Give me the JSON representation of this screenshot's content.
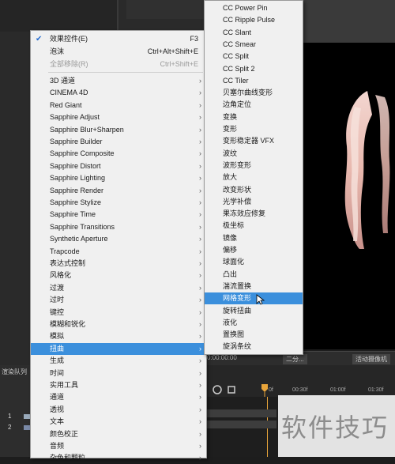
{
  "menu": {
    "items": [
      {
        "label": "效果控件(E)",
        "shortcut": "F3",
        "checked": true
      },
      {
        "label": "泡沫",
        "shortcut": "Ctrl+Alt+Shift+E"
      },
      {
        "label": "全部移除(R)",
        "shortcut": "Ctrl+Shift+E",
        "disabled": true
      },
      {
        "label": "3D 通道"
      },
      {
        "label": "CINEMA 4D"
      },
      {
        "label": "Red Giant"
      },
      {
        "label": "Sapphire Adjust"
      },
      {
        "label": "Sapphire Blur+Sharpen"
      },
      {
        "label": "Sapphire Builder"
      },
      {
        "label": "Sapphire Composite"
      },
      {
        "label": "Sapphire Distort"
      },
      {
        "label": "Sapphire Lighting"
      },
      {
        "label": "Sapphire Render"
      },
      {
        "label": "Sapphire Stylize"
      },
      {
        "label": "Sapphire Time"
      },
      {
        "label": "Sapphire Transitions"
      },
      {
        "label": "Synthetic Aperture"
      },
      {
        "label": "Trapcode"
      },
      {
        "label": "表达式控制"
      },
      {
        "label": "风格化"
      },
      {
        "label": "过渡"
      },
      {
        "label": "过时"
      },
      {
        "label": "键控"
      },
      {
        "label": "模糊和锐化"
      },
      {
        "label": "模拟"
      },
      {
        "label": "扭曲",
        "highlighted": true
      },
      {
        "label": "生成"
      },
      {
        "label": "时间"
      },
      {
        "label": "实用工具"
      },
      {
        "label": "通道"
      },
      {
        "label": "透视"
      },
      {
        "label": "文本"
      },
      {
        "label": "颜色校正"
      },
      {
        "label": "音频"
      },
      {
        "label": "杂色和颗粒"
      }
    ]
  },
  "submenu": {
    "items": [
      {
        "label": "CC Power Pin"
      },
      {
        "label": "CC Ripple Pulse"
      },
      {
        "label": "CC Slant"
      },
      {
        "label": "CC Smear"
      },
      {
        "label": "CC Split"
      },
      {
        "label": "CC Split 2"
      },
      {
        "label": "CC Tiler"
      },
      {
        "label": "贝塞尔曲线变形"
      },
      {
        "label": "边角定位"
      },
      {
        "label": "变换"
      },
      {
        "label": "变形"
      },
      {
        "label": "变形稳定器 VFX"
      },
      {
        "label": "波纹"
      },
      {
        "label": "波形变形"
      },
      {
        "label": "放大"
      },
      {
        "label": "改变形状"
      },
      {
        "label": "光学补偿"
      },
      {
        "label": "果冻效应修复"
      },
      {
        "label": "极坐标"
      },
      {
        "label": "镜像"
      },
      {
        "label": "偏移"
      },
      {
        "label": "球面化"
      },
      {
        "label": "凸出"
      },
      {
        "label": "湍流置换"
      },
      {
        "label": "网格变形",
        "highlighted": true
      },
      {
        "label": "旋转扭曲"
      },
      {
        "label": "液化"
      },
      {
        "label": "置换图"
      },
      {
        "label": "旋涡条纹"
      }
    ]
  },
  "timeline": {
    "timecode": "0:00:00:00",
    "camera_button": "活动摄像机",
    "view_button": "二分...",
    "ruler_ticks": [
      "0f",
      "00:30f",
      "01:00f",
      "01:30f"
    ],
    "panel_label": "渲染队列",
    "layer_rows": [
      "1",
      "2"
    ]
  },
  "watermark": "软件技巧",
  "colors": {
    "highlight": "#3b8fdc",
    "menu_bg": "#f0f0f0",
    "checkmark": "#2a6fd0"
  }
}
